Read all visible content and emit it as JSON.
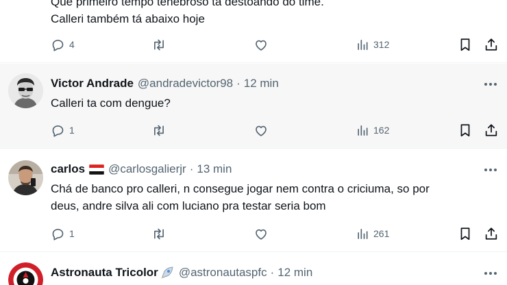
{
  "posts": [
    {
      "text_lines": [
        "Que primeiro tempo tenebroso tá destoando do time.",
        "Calleri também tá abaixo hoje"
      ],
      "actions": {
        "replies": "4",
        "views": "312"
      }
    },
    {
      "name": "Victor Andrade",
      "handle": "@andradevictor98",
      "time": "12 min",
      "text_lines": [
        "Calleri ta com dengue?"
      ],
      "actions": {
        "replies": "1",
        "views": "162"
      }
    },
    {
      "name": "carlos",
      "handle": "@carlosgalierjr",
      "time": "13 min",
      "text_lines": [
        "Chá de banco pro calleri, n consegue jogar nem contra o criciuma, so por",
        "deus, andre silva ali com luciano pra testar seria bom"
      ],
      "actions": {
        "replies": "1",
        "views": "261"
      }
    },
    {
      "name": "Astronauta Tricolor",
      "handle": "@astronautaspfc",
      "time": "12 min"
    }
  ],
  "separator": "·",
  "icons": {
    "reply": "speech-bubble-icon",
    "repost": "repost-arrows-icon",
    "like": "heart-icon",
    "views": "bar-chart-icon",
    "bookmark": "bookmark-icon",
    "share": "share-upload-icon",
    "more": "more-dots-icon",
    "flag": "flag-icon",
    "rocket": "rocket-emoji-icon"
  },
  "colors": {
    "text": "#0f1419",
    "secondary": "#536471",
    "hover_bg": "#f7f7f7",
    "divider": "#eff3f4"
  }
}
